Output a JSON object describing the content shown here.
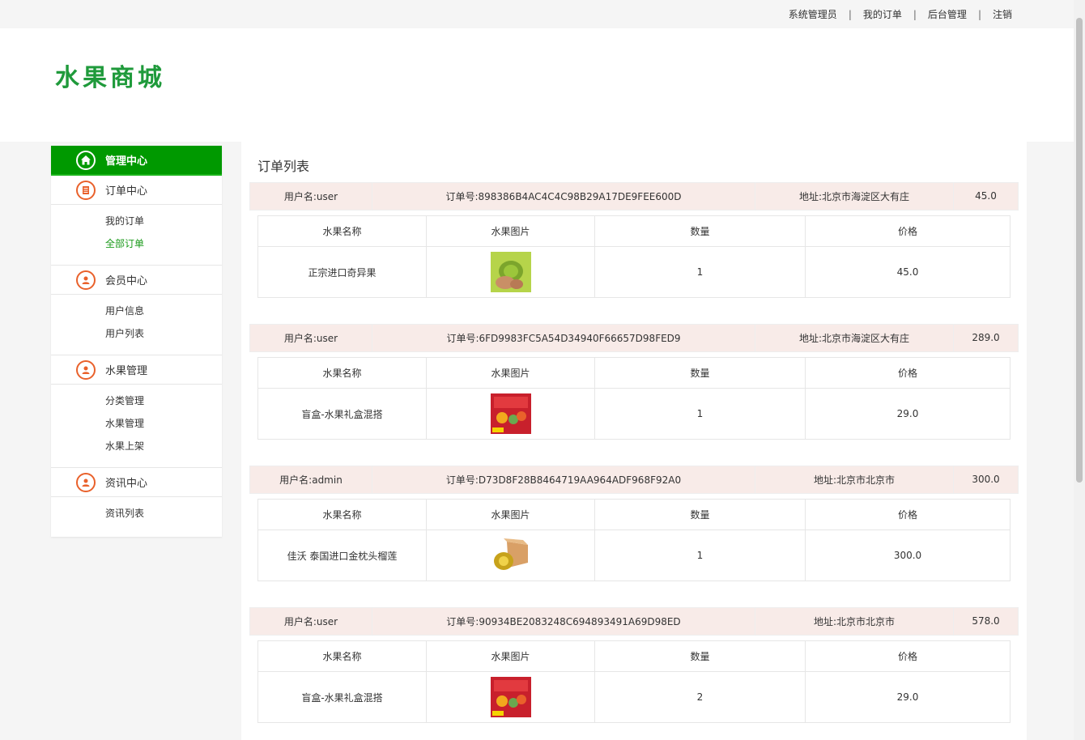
{
  "topnav": {
    "admin": "系统管理员",
    "my_orders": "我的订单",
    "backend": "后台管理",
    "logout": "注销",
    "separator": "|"
  },
  "logo": {
    "text": "水果商城",
    "color": "#1f9a3b"
  },
  "sidebar": {
    "management": "管理中心",
    "order_center": "订单中心",
    "my_orders": "我的订单",
    "all_orders": "全部订单",
    "member_center": "会员中心",
    "user_info": "用户信息",
    "user_list": "用户列表",
    "fruit_mgmt": "水果管理",
    "category_mgmt": "分类管理",
    "fruit_manage": "水果管理",
    "fruit_list": "水果上架",
    "news_center": "资讯中心",
    "news_list": "资讯列表"
  },
  "main": {
    "title": "订单列表"
  },
  "table_headers": {
    "name": "水果名称",
    "image": "水果图片",
    "qty": "数量",
    "price": "价格"
  },
  "orders": [
    {
      "user": "用户名:user",
      "order_no": "订单号:898386B4AC4C4C98B29A17DE9FEE600D",
      "address": "地址:北京市海淀区大有庄",
      "total": "45.0",
      "item": {
        "name": "正宗进口奇异果",
        "image": "kiwi-image",
        "qty": "1",
        "price": "45.0"
      }
    },
    {
      "user": "用户名:user",
      "order_no": "订单号:6FD9983FC5A54D34940F66657D98FED9",
      "address": "地址:北京市海淀区大有庄",
      "total": "289.0",
      "item": {
        "name": "盲盒-水果礼盒混搭",
        "image": "gift-box-image",
        "qty": "1",
        "price": "29.0"
      }
    },
    {
      "user": "用户名:admin",
      "order_no": "订单号:D73D8F28B8464719AA964ADF968F92A0",
      "address": "地址:北京市北京市",
      "total": "300.0",
      "item": {
        "name": "佳沃 泰国进口金枕头榴莲",
        "image": "durian-image",
        "qty": "1",
        "price": "300.0"
      }
    },
    {
      "user": "用户名:user",
      "order_no": "订单号:90934BE2083248C694893491A69D98ED",
      "address": "地址:北京市北京市",
      "total": "578.0",
      "item": {
        "name": "盲盒-水果礼盒混搭",
        "image": "gift-box-image",
        "qty": "2",
        "price": "29.0"
      }
    }
  ],
  "colors": {
    "accent_green": "#009900",
    "order_header_bg": "#f8ebe8",
    "icon_orange": "#e9612b"
  }
}
